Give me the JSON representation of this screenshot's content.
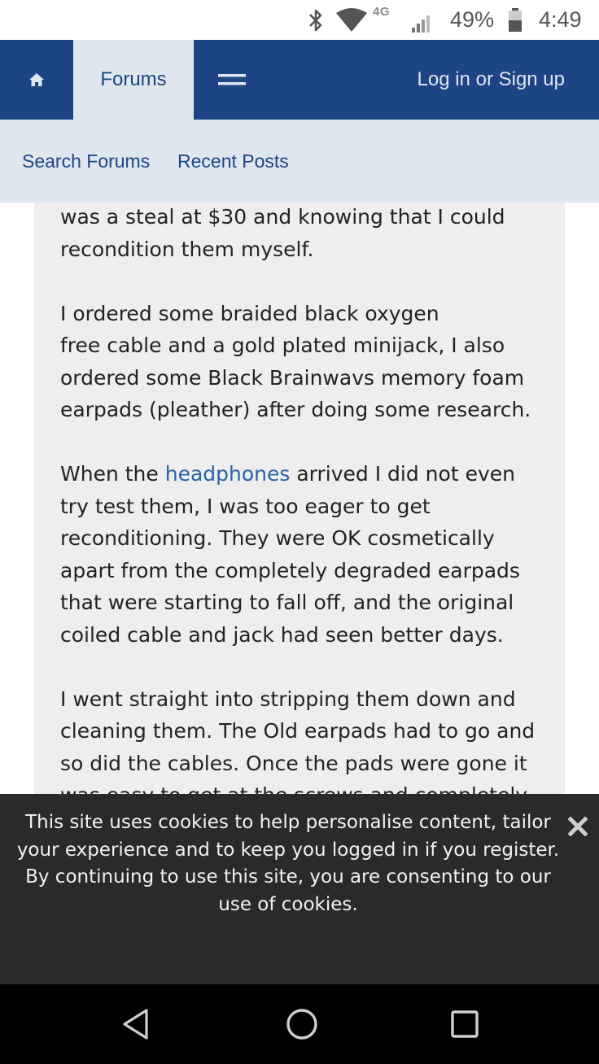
{
  "status_bar": {
    "network": "4G",
    "battery": "49%",
    "time": "4:49",
    "icons": [
      "bluetooth-icon",
      "wifi-icon",
      "signal-icon",
      "battery-icon"
    ]
  },
  "nav": {
    "home_icon": "home-icon",
    "forums_label": "Forums",
    "menu_icon": "hamburger-menu-icon",
    "login_label": "Log in or Sign up"
  },
  "subnav": {
    "search_label": "Search Forums",
    "recent_label": "Recent Posts"
  },
  "post": {
    "p1": "was a steal at $30 and knowing that I could recondition them myself.",
    "p2a": "I ordered some braided black oxygen",
    "p2b": "free cable and a gold plated minijack, I also ordered some Black Brainwavs memory foam earpads (pleather) after doing some research.",
    "p3_before": "When the ",
    "p3_link": "headphones",
    "p3_after": " arrived I did not even try test them, I was too eager to get reconditioning. They were OK cosmetically apart from the completely degraded earpads that were starting to fall off, and the original coiled cable and jack had seen better days.",
    "p4": "I went straight into stripping them down and cleaning them. The Old earpads had to go and so did the cables. Once the pads were gone it was easy to get at the screws and completely"
  },
  "cookie": {
    "line1": "This site uses cookies to help personalise content, tailor your experience and to keep you logged in if you register.",
    "line2": "By continuing to use this site, you are consenting to our use of cookies.",
    "close_icon": "close-icon"
  },
  "system_nav": {
    "icons": [
      "back-icon",
      "home-circle-icon",
      "recents-icon"
    ]
  },
  "colors": {
    "nav_bg": "#1d4585",
    "nav_active_bg": "#dfe6ee",
    "link": "#2b63a8",
    "post_bg": "#eeeeee",
    "cookie_bg": "#2a2a2a"
  }
}
